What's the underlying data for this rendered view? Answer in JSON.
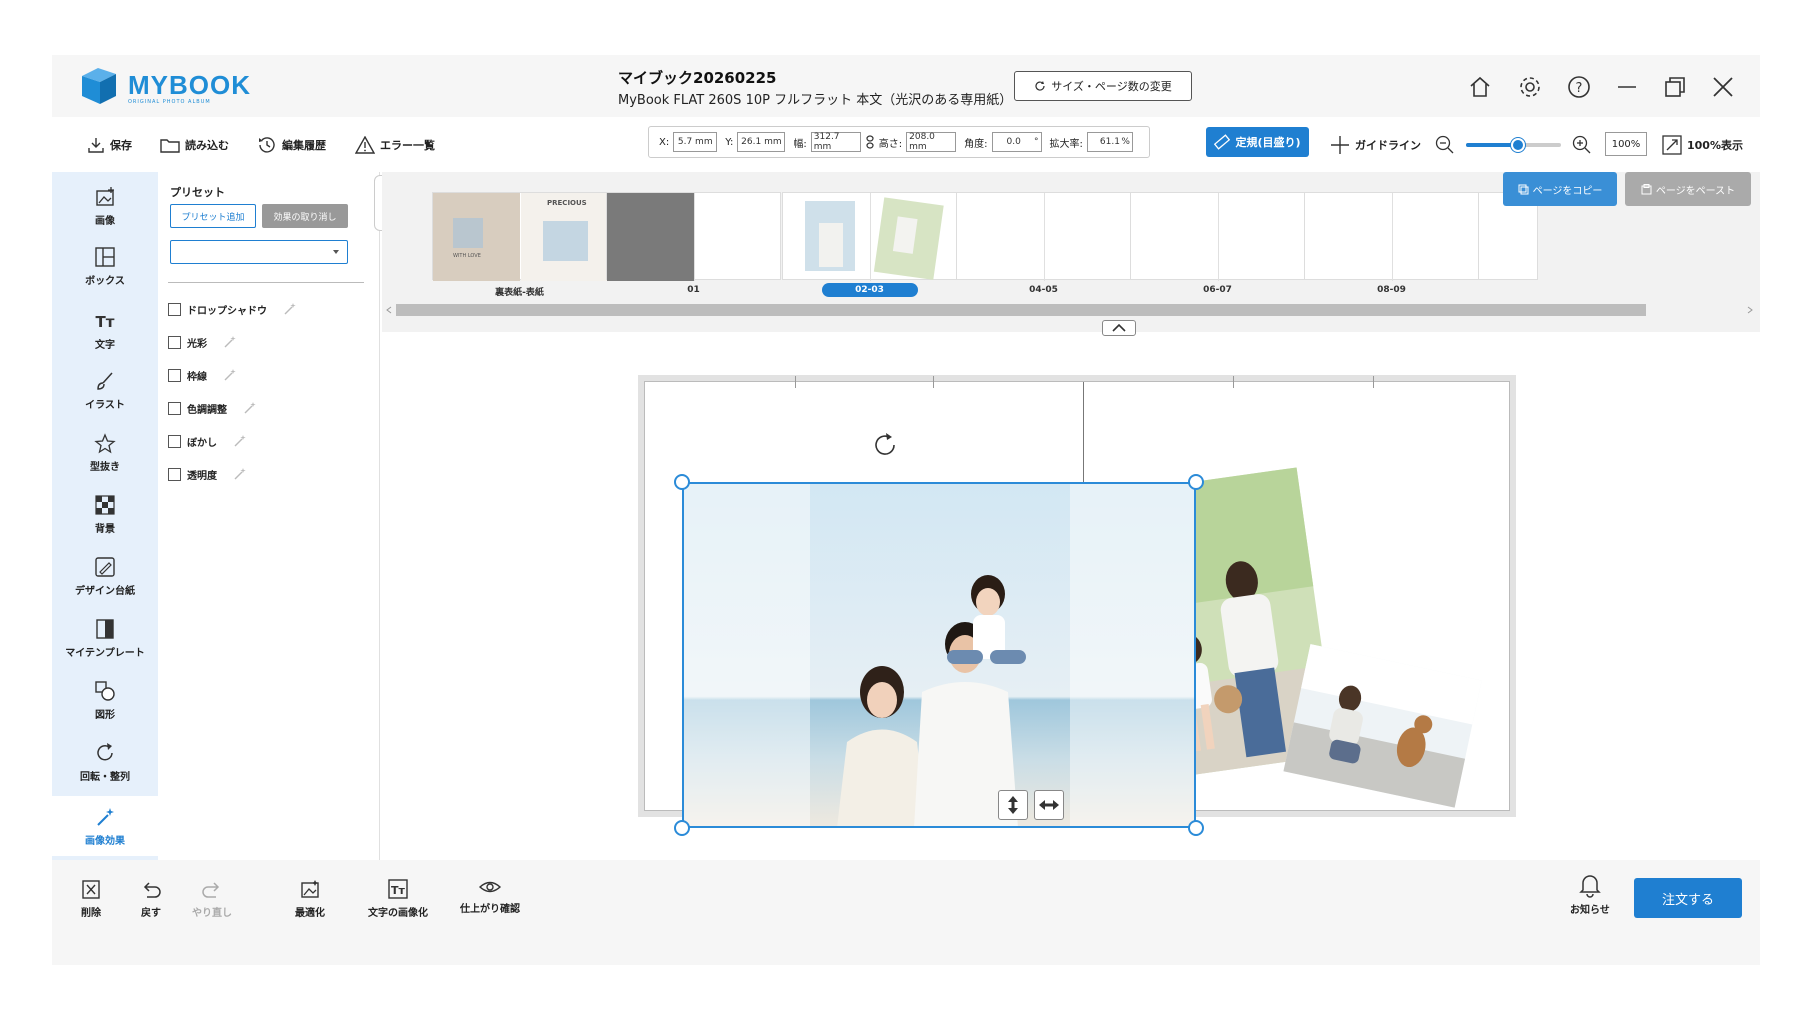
{
  "app": {
    "logo_text": "MYBOOK",
    "logo_sub": "ORIGINAL PHOTO ALBUM"
  },
  "header": {
    "title": "マイブック20260225",
    "subtitle": "MyBook FLAT 260S 10P フルフラット 本文（光沢のある専用紙）",
    "size_button": "サイズ・ページ数の変更",
    "icons": [
      "home-icon",
      "gear-icon",
      "help-icon",
      "minimize-icon",
      "restore-icon",
      "close-icon"
    ]
  },
  "toolbar": {
    "save": "保存",
    "load": "読み込む",
    "history": "編集履歴",
    "errors": "エラー一覧",
    "coords": {
      "x_label": "X:",
      "x_val": "5.7 mm",
      "y_label": "Y:",
      "y_val": "26.1 mm",
      "w_label": "幅:",
      "w_val": "312.7 mm",
      "h_label": "高さ:",
      "h_val": "208.0 mm",
      "angle_label": "角度:",
      "angle_val": "0.0",
      "angle_unit": "°",
      "scale_label": "拡大率:",
      "scale_val": "61.1",
      "scale_unit": "%"
    },
    "ruler": "定規(目盛り)",
    "guideline": "ガイドライン",
    "zoom_value": "100%",
    "zoom_level": 0.55,
    "full_view": "100%表示"
  },
  "sidebar": {
    "items": [
      {
        "label": "画像",
        "icon": "image-add-icon"
      },
      {
        "label": "ボックス",
        "icon": "box-layout-icon"
      },
      {
        "label": "文字",
        "icon": "text-icon"
      },
      {
        "label": "イラスト",
        "icon": "brush-icon"
      },
      {
        "label": "型抜き",
        "icon": "star-cutout-icon"
      },
      {
        "label": "背景",
        "icon": "checker-background-icon"
      },
      {
        "label": "デザイン台紙",
        "icon": "design-mount-icon"
      },
      {
        "label": "マイテンプレート",
        "icon": "template-icon"
      },
      {
        "label": "図形",
        "icon": "shape-icon"
      },
      {
        "label": "回転・整列",
        "icon": "rotate-align-icon"
      },
      {
        "label": "画像効果",
        "icon": "image-effect-icon"
      }
    ]
  },
  "panel": {
    "title": "プリセット",
    "preset_add": "プリセット追加",
    "preset_clear": "効果の取り消し",
    "effects": [
      {
        "label": "ドロップシャドウ",
        "checked": false
      },
      {
        "label": "光彩",
        "checked": false
      },
      {
        "label": "枠線",
        "checked": false
      },
      {
        "label": "色調調整",
        "checked": false
      },
      {
        "label": "ぼかし",
        "checked": false
      },
      {
        "label": "透明度",
        "checked": false
      }
    ]
  },
  "pages": {
    "thumbs": [
      {
        "label": "裏表紙-表紙",
        "cover_text": "PRECIOUS",
        "cover_sub": "WITH LOVE"
      },
      {
        "label": "01"
      },
      {
        "label": "02-03",
        "active": true
      },
      {
        "label": "04-05"
      },
      {
        "label": "06-07"
      },
      {
        "label": "08-09"
      }
    ],
    "copy_button": "ページをコピー",
    "paste_button": "ページをペースト"
  },
  "pager": {
    "left": "02",
    "right": "03"
  },
  "bottom": {
    "delete": "削除",
    "undo": "戻す",
    "redo": "やり直し",
    "optimize": "最適化",
    "text_to_image": "文字の画像化",
    "preview": "仕上がり確認",
    "notice": "お知らせ",
    "order": "注文する"
  },
  "colors": {
    "accent": "#1f7fd1",
    "sidebar_bg": "#e6f0fb",
    "strip_bg": "#f2f2f2"
  }
}
